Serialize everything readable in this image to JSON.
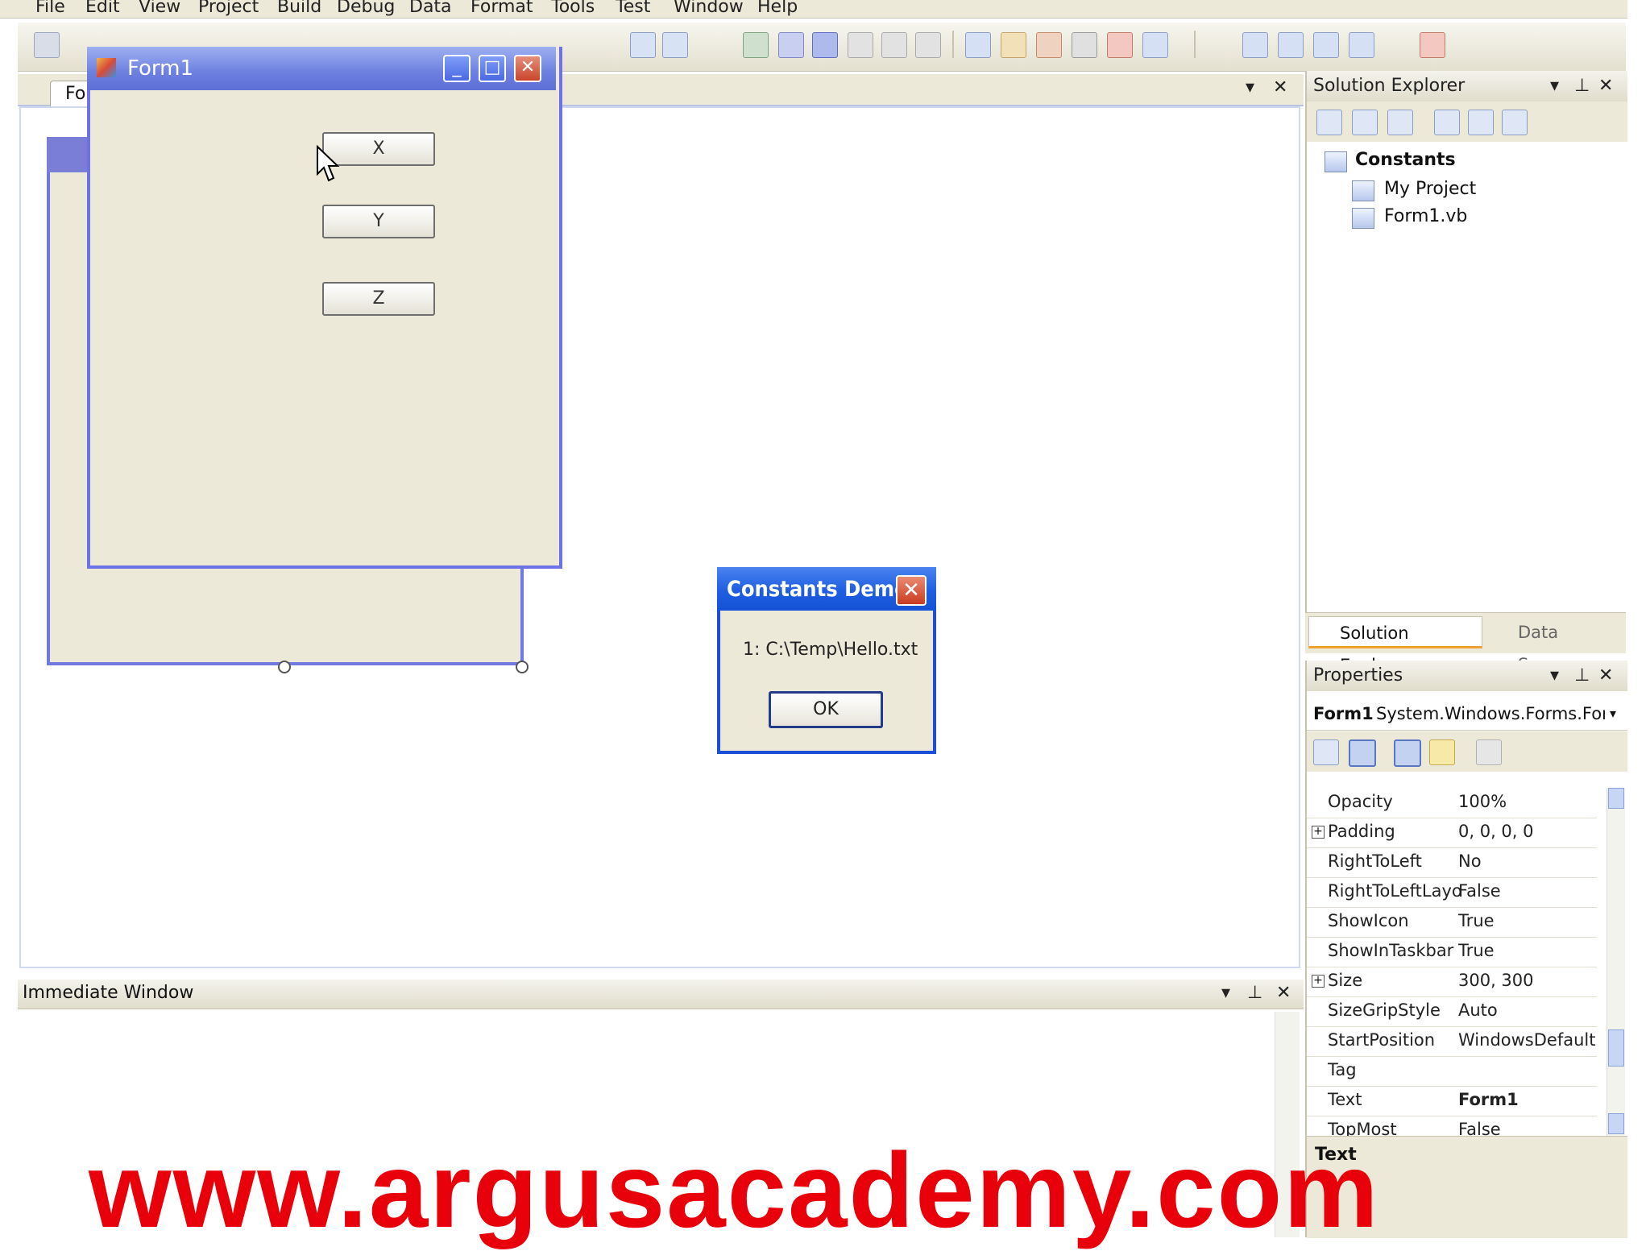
{
  "menu": [
    "File",
    "Edit",
    "View",
    "Project",
    "Build",
    "Debug",
    "Data",
    "Format",
    "Tools",
    "Test",
    "Window",
    "Help"
  ],
  "designer_tab": {
    "label": "Form"
  },
  "form1": {
    "title": "Form1",
    "buttons": [
      "X",
      "Y",
      "Z"
    ]
  },
  "msgbox": {
    "title": "Constants Demo",
    "text": "1: C:\\Temp\\Hello.txt",
    "ok": "OK",
    "close": "✕"
  },
  "solution_explorer": {
    "title": "Solution Explorer",
    "project": "Constants",
    "items": [
      "My Project",
      "Form1.vb"
    ],
    "tabs": [
      "Solution Explorer",
      "Data Sources"
    ]
  },
  "properties": {
    "title": "Properties",
    "object_name": "Form1",
    "object_type": "System.Windows.Forms.Form",
    "rows": [
      {
        "name": "Opacity",
        "value": "100%"
      },
      {
        "name": "Padding",
        "value": "0, 0, 0, 0",
        "expandable": true
      },
      {
        "name": "RightToLeft",
        "value": "No"
      },
      {
        "name": "RightToLeftLayo",
        "value": "False"
      },
      {
        "name": "ShowIcon",
        "value": "True"
      },
      {
        "name": "ShowInTaskbar",
        "value": "True"
      },
      {
        "name": "Size",
        "value": "300, 300",
        "expandable": true
      },
      {
        "name": "SizeGripStyle",
        "value": "Auto"
      },
      {
        "name": "StartPosition",
        "value": "WindowsDefaultL"
      },
      {
        "name": "Tag",
        "value": ""
      },
      {
        "name": "Text",
        "value": "Form1",
        "bold": true
      },
      {
        "name": "TopMost",
        "value": "False"
      }
    ],
    "description_title": "Text"
  },
  "immediate": {
    "title": "Immediate Window"
  },
  "watermark": "www.argusacademy.com",
  "colors": {
    "titlebar_blue": "#1f5ee0",
    "form_border": "#6d73e6",
    "watermark_red": "#e8000b"
  }
}
